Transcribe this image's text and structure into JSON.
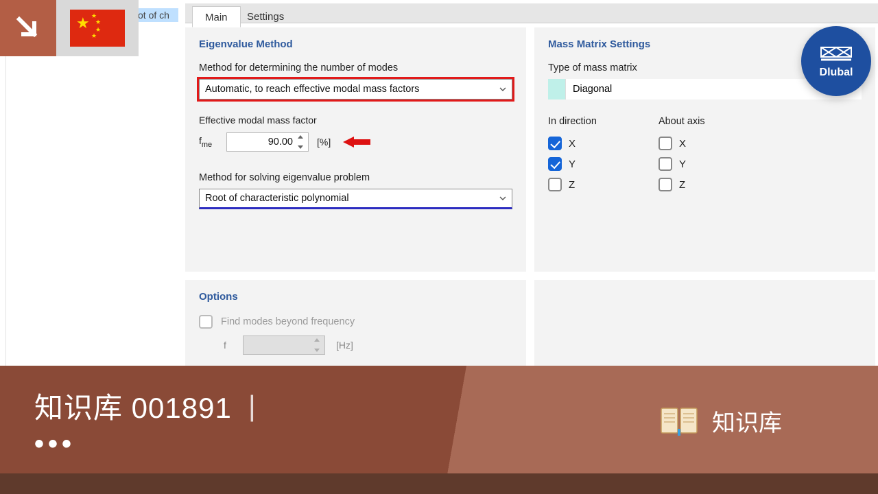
{
  "left_stub_partial_text": "ot of ch",
  "tabs": {
    "main": "Main",
    "settings": "Settings"
  },
  "panel_left": {
    "header": "Eigenvalue Method",
    "modes_label": "Method for determining the number of modes",
    "modes_value": "Automatic, to reach effective modal mass factors",
    "fme_label": "Effective modal mass factor",
    "fme_symbol_main": "f",
    "fme_symbol_sub": "me",
    "fme_value": "90.00",
    "fme_unit": "[%]",
    "solver_label": "Method for solving eigenvalue problem",
    "solver_value": "Root of characteristic polynomial"
  },
  "panel_right": {
    "header": "Mass Matrix Settings",
    "type_label": "Type of mass matrix",
    "type_value": "Diagonal",
    "direction_header": "In direction",
    "axis_header": "About axis",
    "dir_x": "X",
    "dir_y": "Y",
    "dir_z": "Z",
    "ax_x": "X",
    "ax_y": "Y",
    "ax_z": "Z",
    "dir_x_checked": true,
    "dir_y_checked": true,
    "dir_z_checked": false,
    "ax_x_checked": false,
    "ax_y_checked": false,
    "ax_z_checked": false
  },
  "panel_options": {
    "header": "Options",
    "find_beyond_label": "Find modes beyond frequency",
    "f_symbol": "f",
    "f_unit": "[Hz]"
  },
  "logo_text": "Dlubal",
  "band": {
    "title_left": "知识库 001891",
    "dots": "•••",
    "title_right": "知识库"
  }
}
